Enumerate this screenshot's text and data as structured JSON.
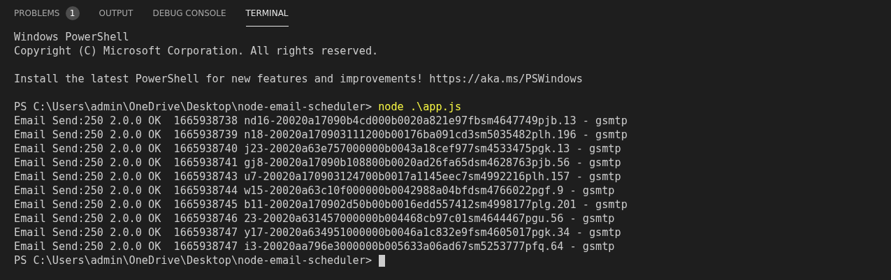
{
  "tabs": [
    {
      "label": "PROBLEMS",
      "selected": false,
      "badge": "1"
    },
    {
      "label": "OUTPUT",
      "selected": false
    },
    {
      "label": "DEBUG CONSOLE",
      "selected": false
    },
    {
      "label": "TERMINAL",
      "selected": true
    }
  ],
  "terminal": {
    "lines": [
      {
        "kind": "text",
        "text": "Windows PowerShell"
      },
      {
        "kind": "text",
        "text": "Copyright (C) Microsoft Corporation. All rights reserved."
      },
      {
        "kind": "blank"
      },
      {
        "kind": "text",
        "text": "Install the latest PowerShell for new features and improvements! https://aka.ms/PSWindows"
      },
      {
        "kind": "blank"
      },
      {
        "kind": "prompt",
        "prompt": "PS C:\\Users\\admin\\OneDrive\\Desktop\\node-email-scheduler>",
        "command": "node .\\app.js",
        "cursor": false
      },
      {
        "kind": "text",
        "text": "Email Send:250 2.0.0 OK  1665938738 nd16-20020a17090b4cd000b0020a821e97fbsm4647749pjb.13 - gsmtp"
      },
      {
        "kind": "text",
        "text": "Email Send:250 2.0.0 OK  1665938739 n18-20020a170903111200b00176ba091cd3sm5035482plh.196 - gsmtp"
      },
      {
        "kind": "text",
        "text": "Email Send:250 2.0.0 OK  1665938740 j23-20020a63e757000000b0043a18cef977sm4533475pgk.13 - gsmtp"
      },
      {
        "kind": "text",
        "text": "Email Send:250 2.0.0 OK  1665938741 gj8-20020a17090b108800b0020ad26fa65dsm4628763pjb.56 - gsmtp"
      },
      {
        "kind": "text",
        "text": "Email Send:250 2.0.0 OK  1665938743 u7-20020a170903124700b0017a1145eec7sm4992216plh.157 - gsmtp"
      },
      {
        "kind": "text",
        "text": "Email Send:250 2.0.0 OK  1665938744 w15-20020a63c10f000000b0042988a04bfdsm4766022pgf.9 - gsmtp"
      },
      {
        "kind": "text",
        "text": "Email Send:250 2.0.0 OK  1665938745 b11-20020a170902d50b00b0016edd557412sm4998177plg.201 - gsmtp"
      },
      {
        "kind": "text",
        "text": "Email Send:250 2.0.0 OK  1665938746 23-20020a631457000000b004468cb97c01sm4644467pgu.56 - gsmtp"
      },
      {
        "kind": "text",
        "text": "Email Send:250 2.0.0 OK  1665938747 y17-20020a634951000000b0046a1c832e9fsm4605017pgk.34 - gsmtp"
      },
      {
        "kind": "text",
        "text": "Email Send:250 2.0.0 OK  1665938747 i3-20020aa796e3000000b005633a06ad67sm5253777pfq.64 - gsmtp"
      },
      {
        "kind": "prompt",
        "prompt": "PS C:\\Users\\admin\\OneDrive\\Desktop\\node-email-scheduler>",
        "cursor": true
      }
    ]
  }
}
